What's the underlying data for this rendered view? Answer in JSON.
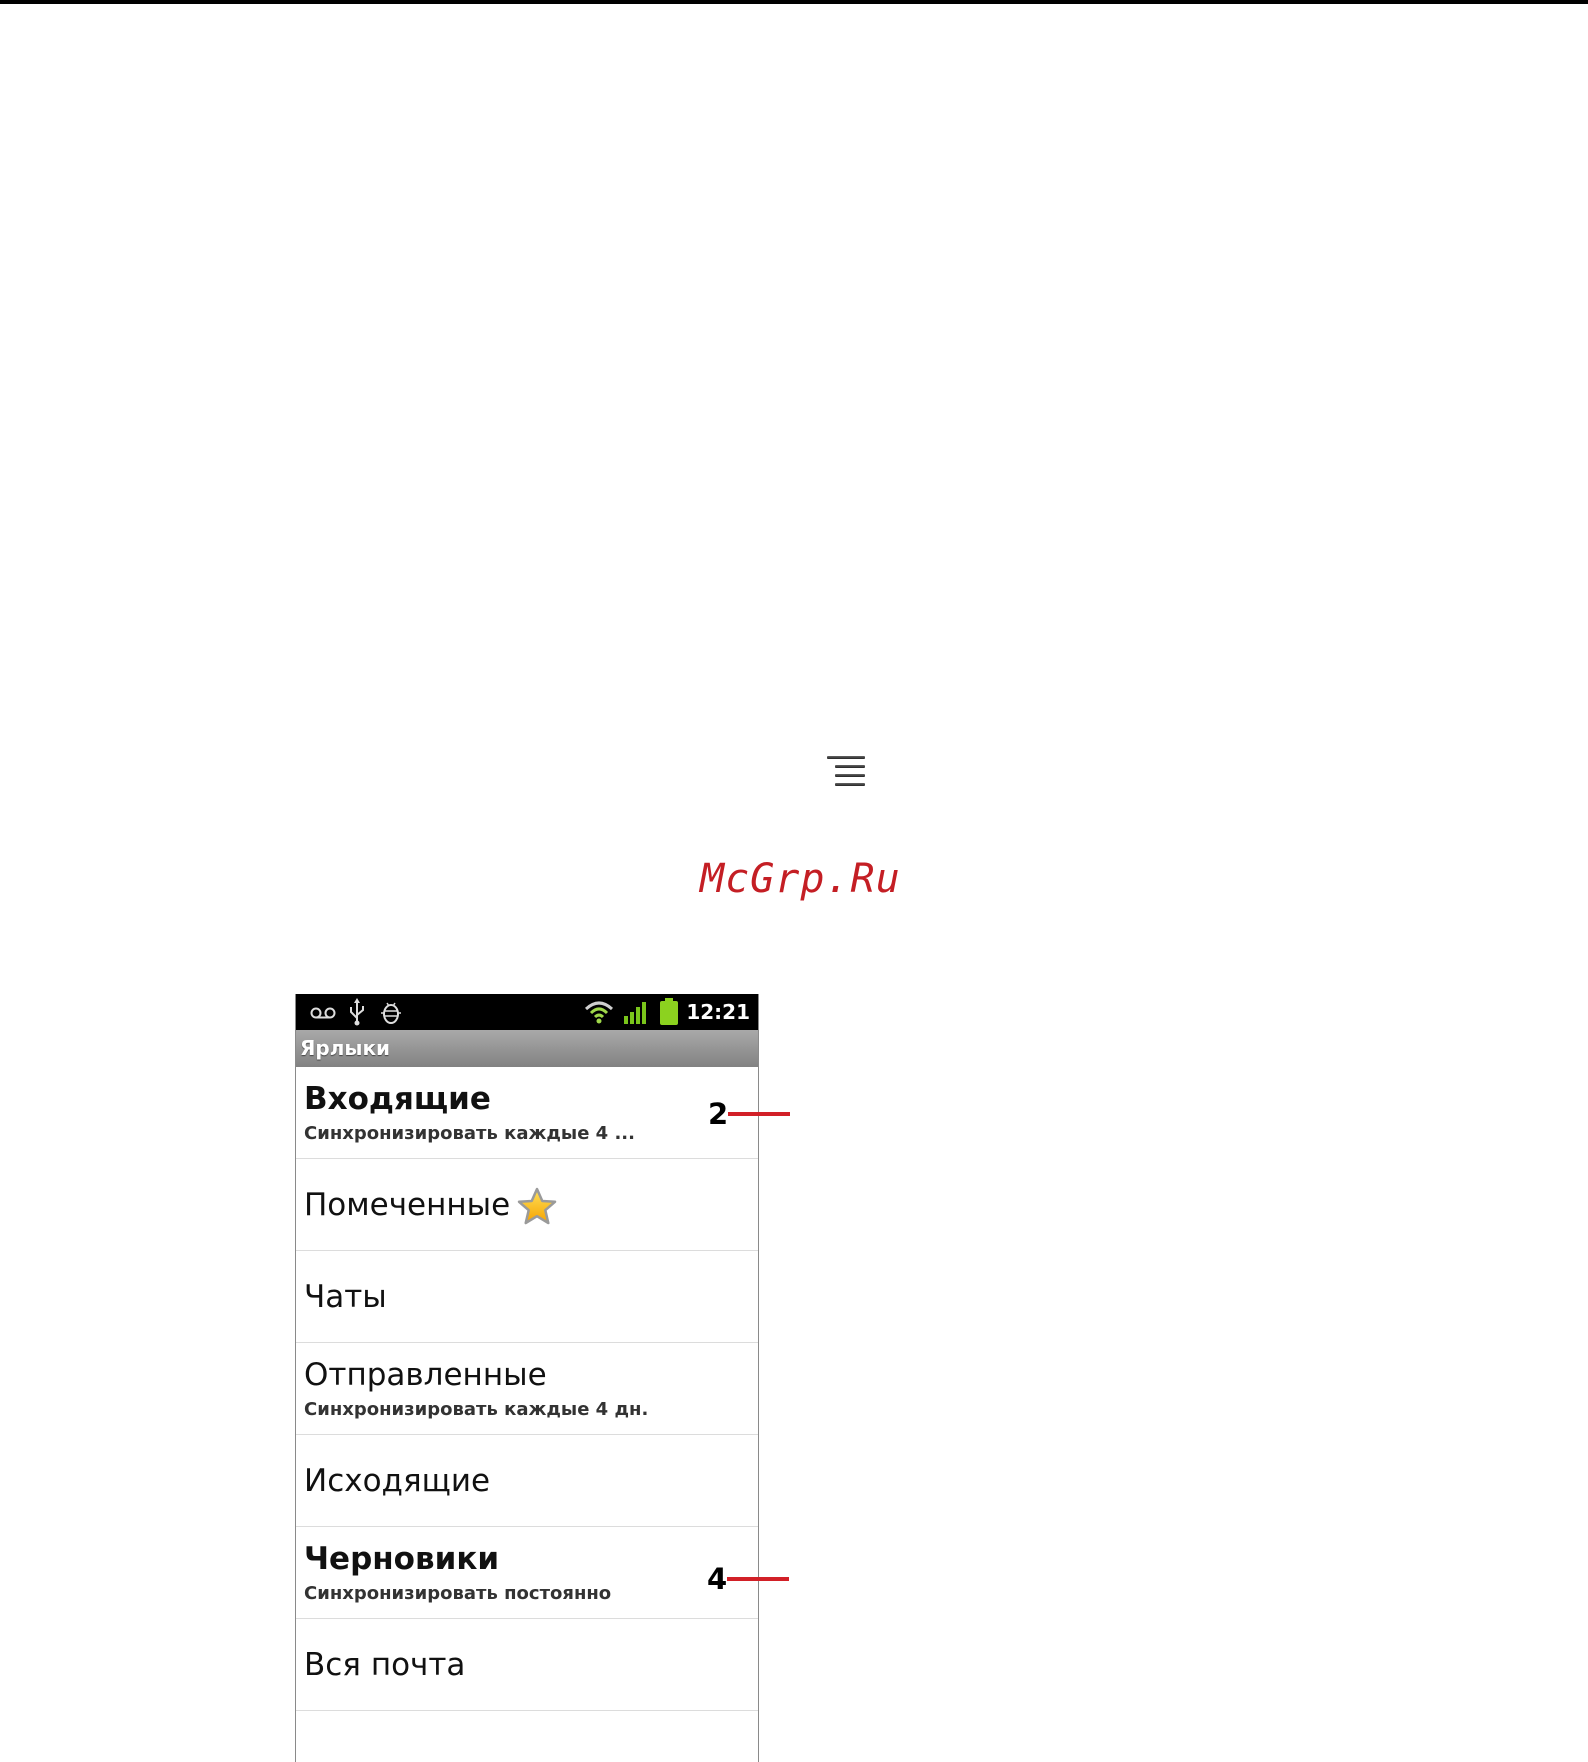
{
  "watermark": "McGrp.Ru",
  "status_bar": {
    "time": "12:21",
    "icons": [
      "voicemail-icon",
      "usb-icon",
      "android-debug-icon",
      "wifi-icon",
      "signal-icon",
      "battery-icon"
    ],
    "signal_color": "#7ac51b",
    "battery_color": "#8cd21f"
  },
  "title_bar": {
    "title": "Ярлыки"
  },
  "labels": [
    {
      "name": "Входящие",
      "subtitle": "Синхронизировать каждые 4 ...",
      "bold": true
    },
    {
      "name": "Помеченные",
      "icon": "star-icon"
    },
    {
      "name": "Чаты"
    },
    {
      "name": "Отправленные",
      "subtitle": "Синхронизировать каждые 4 дн."
    },
    {
      "name": "Исходящие"
    },
    {
      "name": "Черновики",
      "subtitle": "Синхронизировать постоянно",
      "bold": true
    },
    {
      "name": "Вся почта"
    }
  ],
  "callouts": {
    "first": "2",
    "second": "4",
    "color": "#d22027"
  }
}
